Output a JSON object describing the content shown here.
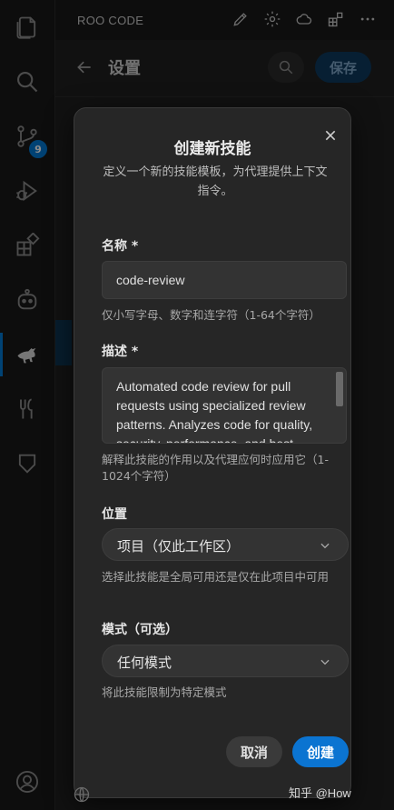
{
  "app": {
    "title": "ROO CODE"
  },
  "activity_bar": {
    "scm_badge": "9",
    "items": [
      "explorer-icon",
      "search-icon",
      "source-control-icon",
      "run-debug-icon",
      "extensions-icon",
      "copilot-icon",
      "roo-kangaroo-icon",
      "kitchen-icon",
      "shield-icon",
      "account-icon"
    ]
  },
  "settings": {
    "title": "设置",
    "save_label": "保存"
  },
  "dialog": {
    "title": "创建新技能",
    "subtitle": "定义一个新的技能模板，为代理提供上下文指令。",
    "name_label": "名称 *",
    "name_value": "code-review",
    "name_help": "仅小写字母、数字和连字符（1-64个字符）",
    "desc_label": "描述 *",
    "desc_value": "Automated code review for pull requests using specialized review patterns. Analyzes code for quality, security, performance, and best",
    "desc_help": "解释此技能的作用以及代理应何时应用它（1-1024个字符）",
    "location_label": "位置",
    "location_value": "项目（仅此工作区）",
    "location_help": "选择此技能是全局可用还是仅在此项目中可用",
    "mode_label": "模式（可选）",
    "mode_value": "任何模式",
    "mode_help": "将此技能限制为特定模式",
    "cancel_label": "取消",
    "create_label": "创建"
  },
  "watermark": "知乎 @How",
  "colors": {
    "accent": "#0b74d1",
    "badge": "#0078d4",
    "background": "#181818",
    "dialog": "#262626"
  }
}
